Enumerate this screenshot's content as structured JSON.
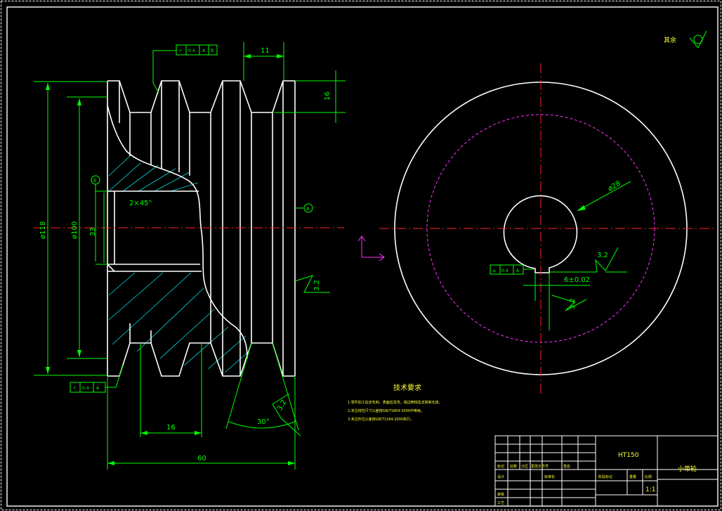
{
  "title_block": {
    "material": "HT150",
    "part_name": "小带轮",
    "scale": "1:1",
    "cells": {
      "mark": "标记",
      "count": "处数",
      "zone": "分区",
      "change_doc": "更改文件号",
      "sign": "签名",
      "design": "设计",
      "standardize": "标准化",
      "review": "审核",
      "process": "工艺",
      "stage_mark": "阶段标记",
      "weight": "重量",
      "ratio": "比例"
    }
  },
  "dimensions": {
    "groove_top_width": "11",
    "groove_depth": "16",
    "dia_outer": "ø118",
    "dia_pitch": "ø100",
    "bore_height": "33",
    "chamfer": "2×45°",
    "groove_pitch": "16",
    "overall_width": "60",
    "groove_angle": "30°",
    "keyway_width": "6±0.02",
    "bore_dia": "ø28"
  },
  "datums": {
    "b": "B",
    "a": "A"
  },
  "tolerance_frames": {
    "runout_top": {
      "symbol": "↗",
      "value": "0.4",
      "datum": "A",
      "datum2": "B"
    },
    "runout_bottom": {
      "symbol": "↗",
      "value": "0.4",
      "datum": "A"
    },
    "symmetry": {
      "symbol": "≡",
      "value": "0.4",
      "datum": "A"
    }
  },
  "roughness": {
    "side": "3.2",
    "groove": "3.2",
    "keyway_top": "3.2",
    "keyway_side": "3.2",
    "other": "其余"
  },
  "tech_req": {
    "title": "技术要求",
    "items": [
      "1.零件加工后去毛刺、表面应清洗、锐边倒钝及去除氧化皮。",
      "2.未注线性尺寸公差按GB/T1804-2000中等级。",
      "3.未注形位公差按GB/T1184-2000执行。"
    ]
  }
}
